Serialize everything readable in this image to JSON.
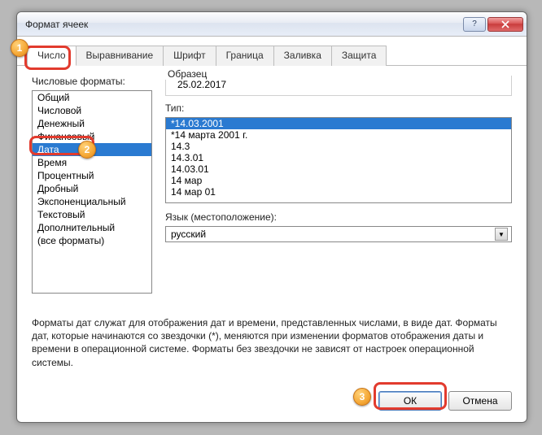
{
  "window": {
    "title": "Формат ячеек"
  },
  "tabs": [
    {
      "label": "Число",
      "active": true
    },
    {
      "label": "Выравнивание",
      "active": false
    },
    {
      "label": "Шрифт",
      "active": false
    },
    {
      "label": "Граница",
      "active": false
    },
    {
      "label": "Заливка",
      "active": false
    },
    {
      "label": "Защита",
      "active": false
    }
  ],
  "labels": {
    "categories": "Числовые форматы:",
    "sample": "Образец",
    "type": "Тип:",
    "language": "Язык (местоположение):"
  },
  "categories": [
    "Общий",
    "Числовой",
    "Денежный",
    "Финансовый",
    "Дата",
    "Время",
    "Процентный",
    "Дробный",
    "Экспоненциальный",
    "Текстовый",
    "Дополнительный",
    "(все форматы)"
  ],
  "selected_category_index": 4,
  "sample_value": "25.02.2017",
  "types": [
    "*14.03.2001",
    "*14 марта 2001 г.",
    "14.3",
    "14.3.01",
    "14.03.01",
    "14 мар",
    "14 мар 01"
  ],
  "selected_type_index": 0,
  "language": "русский",
  "description": "Форматы дат служат для отображения дат и времени, представленных числами, в виде дат. Форматы дат, которые начинаются со звездочки (*), меняются при изменении форматов отображения даты и времени в операционной системе. Форматы без звездочки не зависят от настроек операционной системы.",
  "buttons": {
    "ok": "ОК",
    "cancel": "Отмена"
  },
  "annotations": {
    "m1": "1",
    "m2": "2",
    "m3": "3"
  }
}
